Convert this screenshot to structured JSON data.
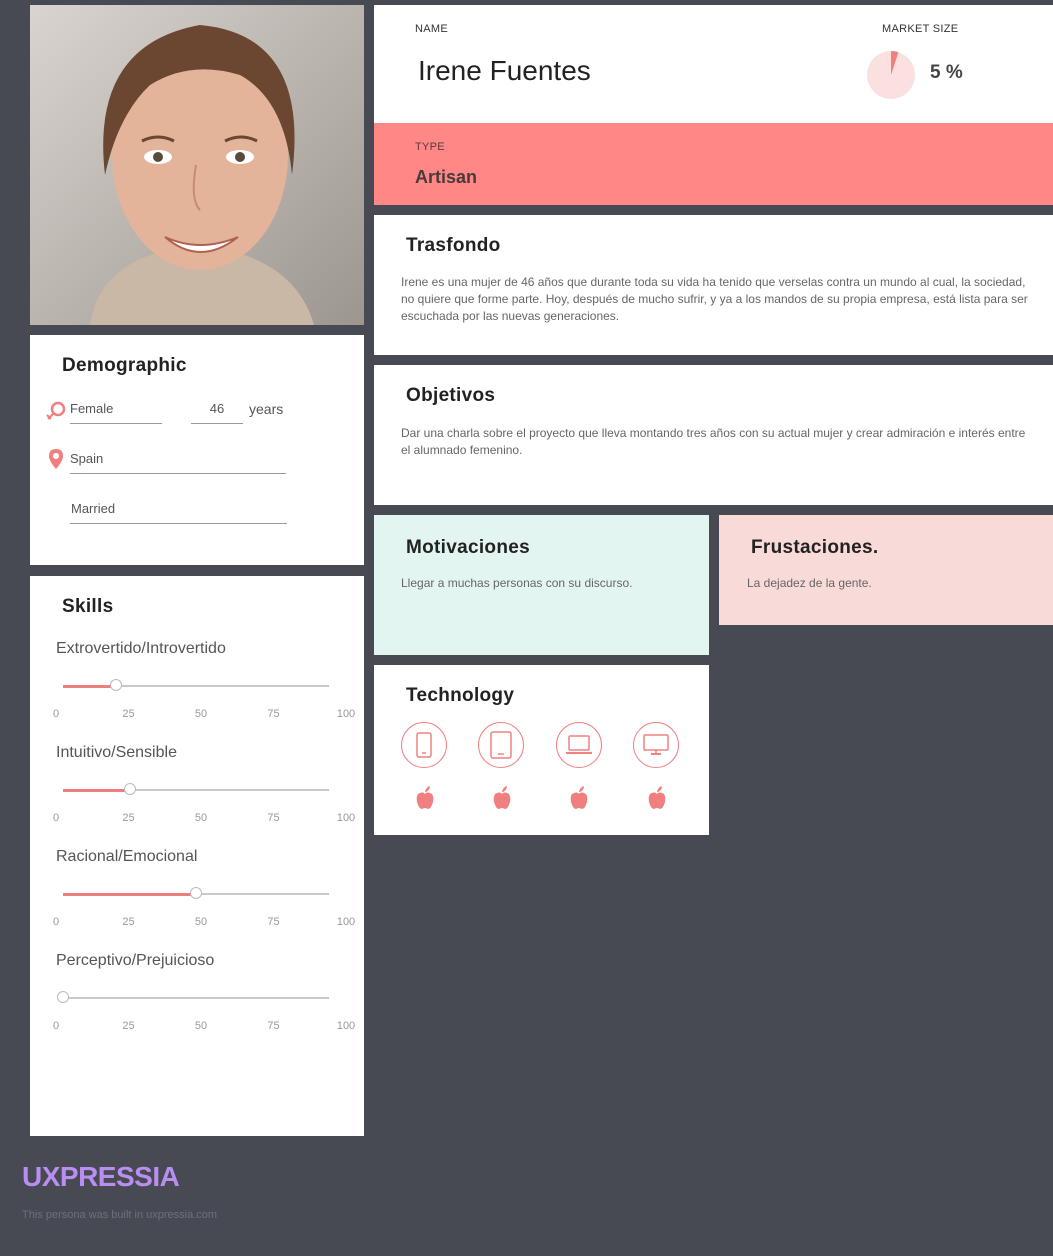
{
  "header": {
    "name_label": "NAME",
    "name": "Irene Fuentes",
    "market_label": "MARKET SIZE",
    "market_value": "5 %",
    "market_fraction": 0.05,
    "type_label": "TYPE",
    "type": "Artisan"
  },
  "background": {
    "title": "Trasfondo",
    "text": "Irene es una mujer de 46 años que durante toda su vida ha tenido que verselas contra un mundo al cual, la sociedad, no quiere que forme parte. Hoy, después de mucho sufrir, y ya a los mandos de su propia empresa, está lista para ser escuchada por las nuevas generaciones."
  },
  "goals": {
    "title": "Objetivos",
    "text": "Dar una charla sobre el proyecto que lleva montando tres años con su actual mujer y crear admiración e interés entre el alumnado femenino."
  },
  "motivations": {
    "title": "Motivaciones",
    "text": "Llegar a muchas personas con su discurso."
  },
  "frustrations": {
    "title": "Frustaciones.",
    "text": "La dejadez de la gente."
  },
  "demographic": {
    "title": "Demographic",
    "gender": "Female",
    "age": "46",
    "age_unit": "years",
    "location": "Spain",
    "status": "Married"
  },
  "skills": {
    "title": "Skills",
    "tick_labels": [
      "0",
      "25",
      "50",
      "75",
      "100"
    ],
    "items": [
      {
        "label": "Extrovertido/Introvertido",
        "value": 20
      },
      {
        "label": "Intuitivo/Sensible",
        "value": 25
      },
      {
        "label": "Racional/Emocional",
        "value": 50
      },
      {
        "label": "Perceptivo/Prejuicioso",
        "value": 0
      }
    ]
  },
  "technology": {
    "title": "Technology",
    "devices": [
      "phone-icon",
      "tablet-icon",
      "laptop-icon",
      "desktop-icon"
    ],
    "platform": "apple-icon"
  },
  "colors": {
    "accent": "#ff8886",
    "background": "#474a53",
    "brand": "#b98ef0",
    "motivations_bg": "#e3f5f1",
    "frustrations_bg": "#f8dad8"
  },
  "footer": {
    "brand": "UXPRESSIA",
    "note": "This persona was built in uxpressia.com"
  }
}
